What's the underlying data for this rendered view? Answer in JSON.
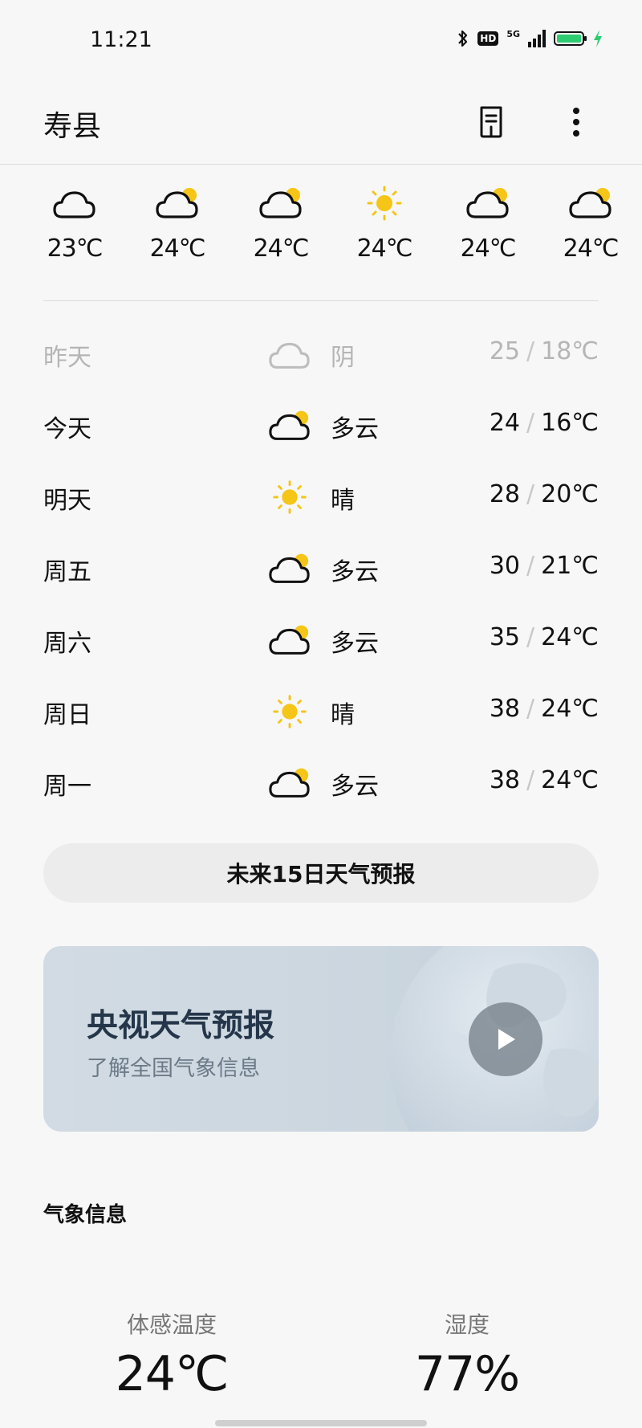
{
  "status_bar": {
    "time": "11:21",
    "hd": "HD",
    "network": "5G"
  },
  "header": {
    "city": "寿县"
  },
  "hourly": [
    {
      "condition": "cloudy-icon",
      "temp": "23℃"
    },
    {
      "condition": "partly-cloudy-icon",
      "temp": "24℃"
    },
    {
      "condition": "partly-cloudy-icon",
      "temp": "24℃"
    },
    {
      "condition": "sunny-icon",
      "temp": "24℃"
    },
    {
      "condition": "partly-cloudy-icon",
      "temp": "24℃"
    },
    {
      "condition": "partly-cloudy-icon",
      "temp": "24℃"
    }
  ],
  "daily": [
    {
      "day": "昨天",
      "icon": "cloudy-icon",
      "condition": "阴",
      "high": "25",
      "low": "18℃"
    },
    {
      "day": "今天",
      "icon": "partly-cloudy-icon",
      "condition": "多云",
      "high": "24",
      "low": "16℃"
    },
    {
      "day": "明天",
      "icon": "sunny-icon",
      "condition": "晴",
      "high": "28",
      "low": "20℃"
    },
    {
      "day": "周五",
      "icon": "partly-cloudy-icon",
      "condition": "多云",
      "high": "30",
      "low": "21℃"
    },
    {
      "day": "周六",
      "icon": "partly-cloudy-icon",
      "condition": "多云",
      "high": "35",
      "low": "24℃"
    },
    {
      "day": "周日",
      "icon": "sunny-icon",
      "condition": "晴",
      "high": "38",
      "low": "24℃"
    },
    {
      "day": "周一",
      "icon": "partly-cloudy-icon",
      "condition": "多云",
      "high": "38",
      "low": "24℃"
    }
  ],
  "temp_separator": "/",
  "forecast_button": "未来15日天气预报",
  "cctv_card": {
    "title": "央视天气预报",
    "subtitle": "了解全国气象信息"
  },
  "section_title": "气象信息",
  "metrics": [
    {
      "label": "体感温度",
      "value": "24℃"
    },
    {
      "label": "湿度",
      "value": "77%"
    }
  ],
  "colors": {
    "sun": "#f5c518",
    "battery": "#2ecc71",
    "charging": "#2ecc71",
    "card_title": "#25364a"
  }
}
